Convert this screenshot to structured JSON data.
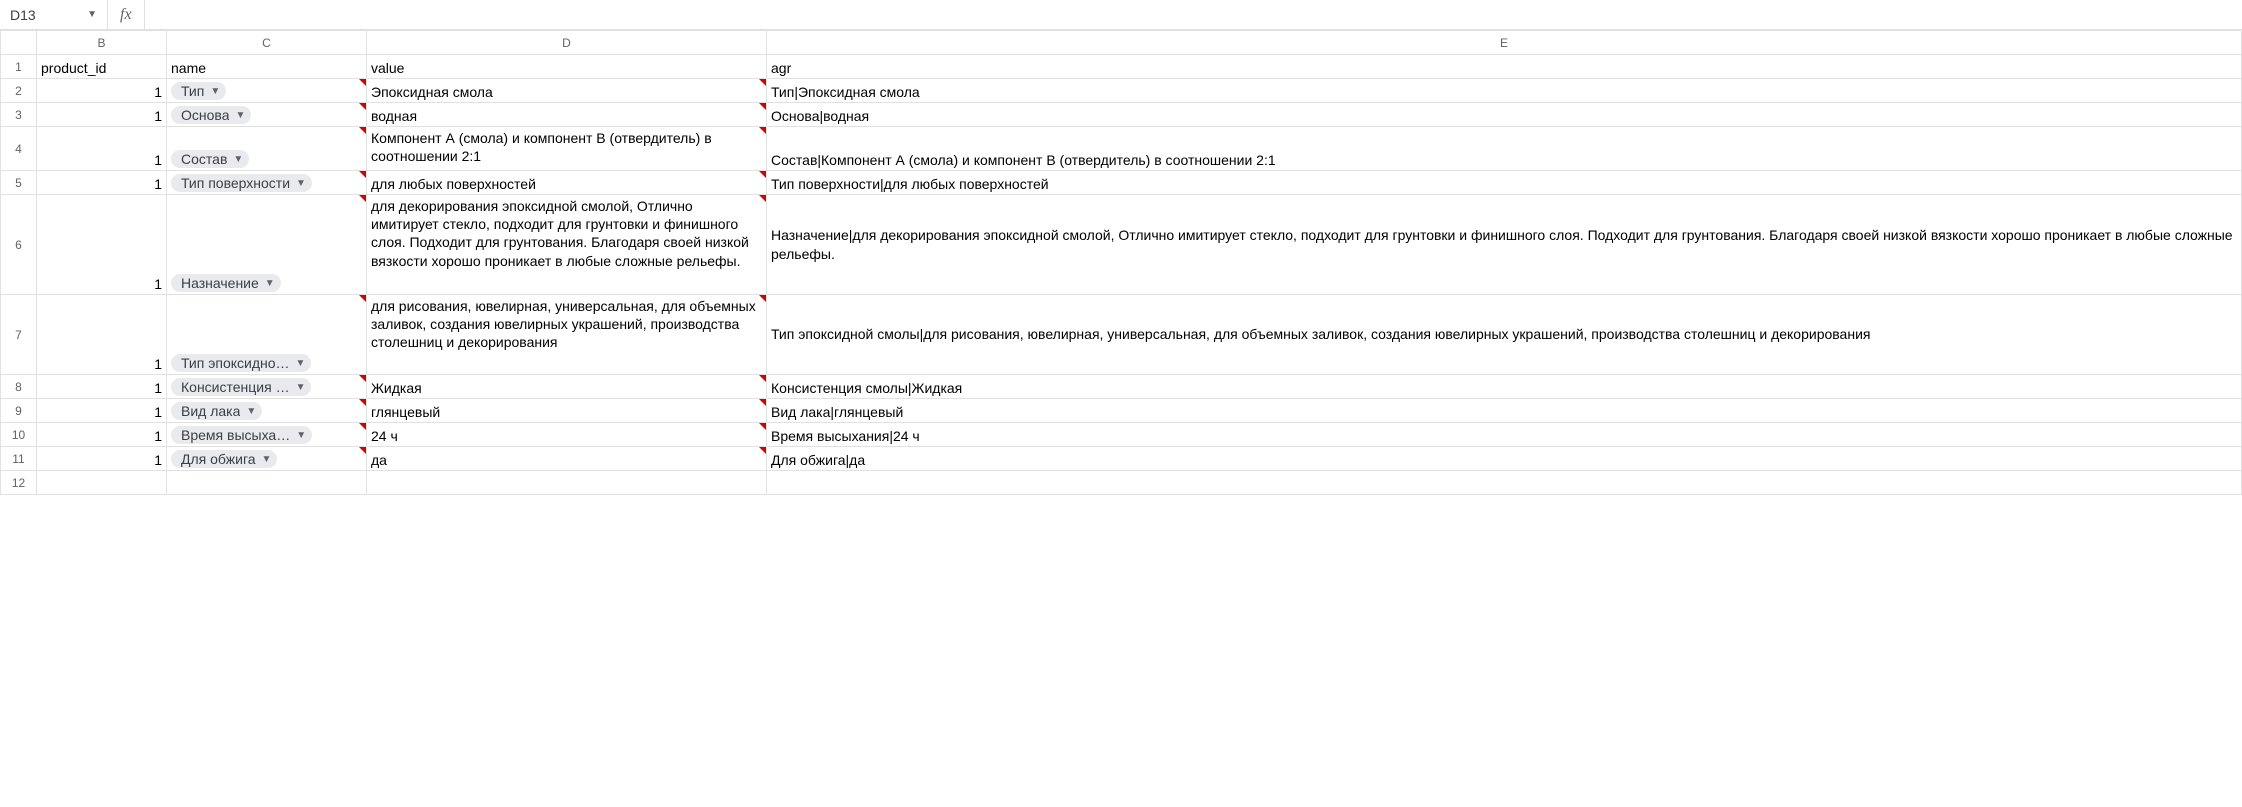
{
  "name_box": {
    "cell_ref": "D13"
  },
  "fx": {
    "label": "fx",
    "value": ""
  },
  "columns": [
    "B",
    "C",
    "D",
    "E"
  ],
  "active_column": "D",
  "headers": {
    "B": "product_id",
    "C": "name",
    "D": "value",
    "E": "agr"
  },
  "rows": [
    {
      "n": 2,
      "B": "1",
      "C": "Тип",
      "D": "Эпоксидная смола",
      "E": "Тип|Эпоксидная смола"
    },
    {
      "n": 3,
      "B": "1",
      "C": "Основа",
      "D": "водная",
      "E": "Основа|водная"
    },
    {
      "n": 4,
      "B": "1",
      "C": "Состав",
      "D": "Компонент А (смола) и компонент В (отвердитель) в соотношении 2:1",
      "E": "Состав|Компонент А (смола) и компонент В (отвердитель) в соотношении 2:1"
    },
    {
      "n": 5,
      "B": "1",
      "C": "Тип поверхности",
      "D": "для любых поверхностей",
      "E": "Тип поверхности|для любых поверхностей"
    },
    {
      "n": 6,
      "B": "1",
      "C": "Назначение",
      "D": "для декорирования эпоксидной смолой, Отлично имитирует стекло, подходит для грунтовки и финишного слоя. Подходит для грунтования. Благодаря своей низкой вязкости хорошо проникает в любые сложные рельефы.",
      "E": "Назначение|для декорирования эпоксидной смолой, Отлично имитирует стекло, подходит для грунтовки и финишного слоя. Подходит для грунтования. Благодаря своей низкой вязкости хорошо проникает в любые сложные рельефы."
    },
    {
      "n": 7,
      "B": "1",
      "C": "Тип эпоксидно…",
      "C_full": "Тип эпоксидной смолы",
      "D": "для рисования, ювелирная, универсальная, для объемных заливок, создания ювелирных украшений, производства столешниц и декорирования",
      "E": "Тип эпоксидной смолы|для рисования, ювелирная, универсальная, для объемных заливок, создания ювелирных украшений, производства столешниц и декорирования"
    },
    {
      "n": 8,
      "B": "1",
      "C": "Консистенция …",
      "C_full": "Консистенция смолы",
      "D": "Жидкая",
      "E": "Консистенция смолы|Жидкая"
    },
    {
      "n": 9,
      "B": "1",
      "C": "Вид лака",
      "D": "глянцевый",
      "E": "Вид лака|глянцевый"
    },
    {
      "n": 10,
      "B": "1",
      "C": "Время высыха…",
      "C_full": "Время высыхания",
      "D": "24 ч",
      "E": "Время высыхания|24 ч"
    },
    {
      "n": 11,
      "B": "1",
      "C": "Для обжига",
      "D": "да",
      "E": "Для обжига|да"
    }
  ],
  "blank_rows": [
    12
  ]
}
